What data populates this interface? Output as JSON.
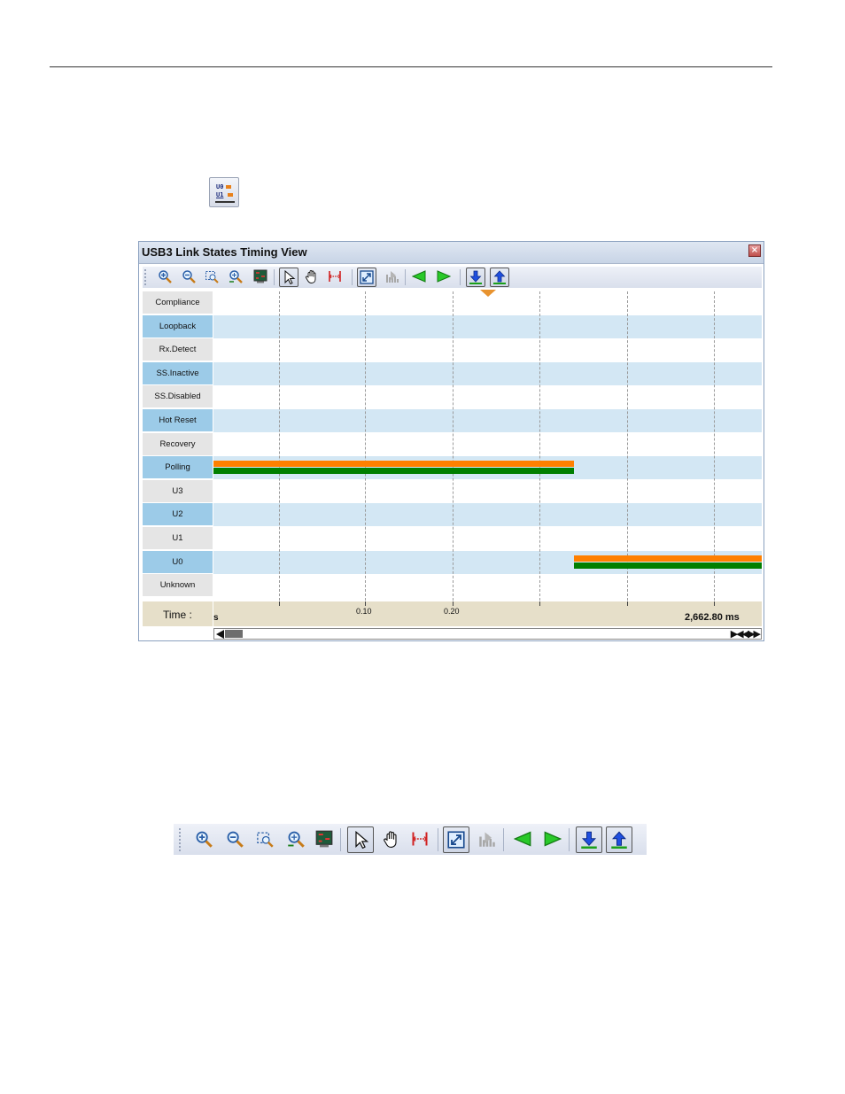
{
  "window": {
    "title": "USB3 Link States Timing View",
    "close_glyph": "×"
  },
  "toolbar_icons": [
    "zoom-in-icon",
    "zoom-out-icon",
    "zoom-selection-icon",
    "zoom-fit-icon",
    "waveform-display-icon",
    "pointer-icon",
    "pan-hand-icon",
    "measure-cursor-icon",
    "fit-view-icon",
    "histogram-icon",
    "previous-arrow-icon",
    "next-arrow-icon",
    "move-down-icon",
    "move-up-icon"
  ],
  "states": [
    "Compliance",
    "Loopback",
    "Rx.Detect",
    "SS.Inactive",
    "SS.Disabled",
    "Hot Reset",
    "Recovery",
    "Polling",
    "U3",
    "U2",
    "U1",
    "U0",
    "Unknown"
  ],
  "timeline": {
    "label": "Time :",
    "start_label": "s",
    "ticks": [
      "0.10",
      "0.20"
    ],
    "range_end": "2,662.80 ms"
  },
  "colors": {
    "orange_bar": "#ff8000",
    "green_bar": "#007f00",
    "label_even": "#9ccbe8",
    "band_even": "#d3e7f4"
  },
  "segments": [
    {
      "state": "Polling",
      "start_fraction": 0.0,
      "end_fraction": 0.657
    },
    {
      "state": "U0",
      "start_fraction": 0.657,
      "end_fraction": 1.0
    }
  ],
  "scroll": {
    "nav_glyphs": "▶◀◀▶▶"
  }
}
